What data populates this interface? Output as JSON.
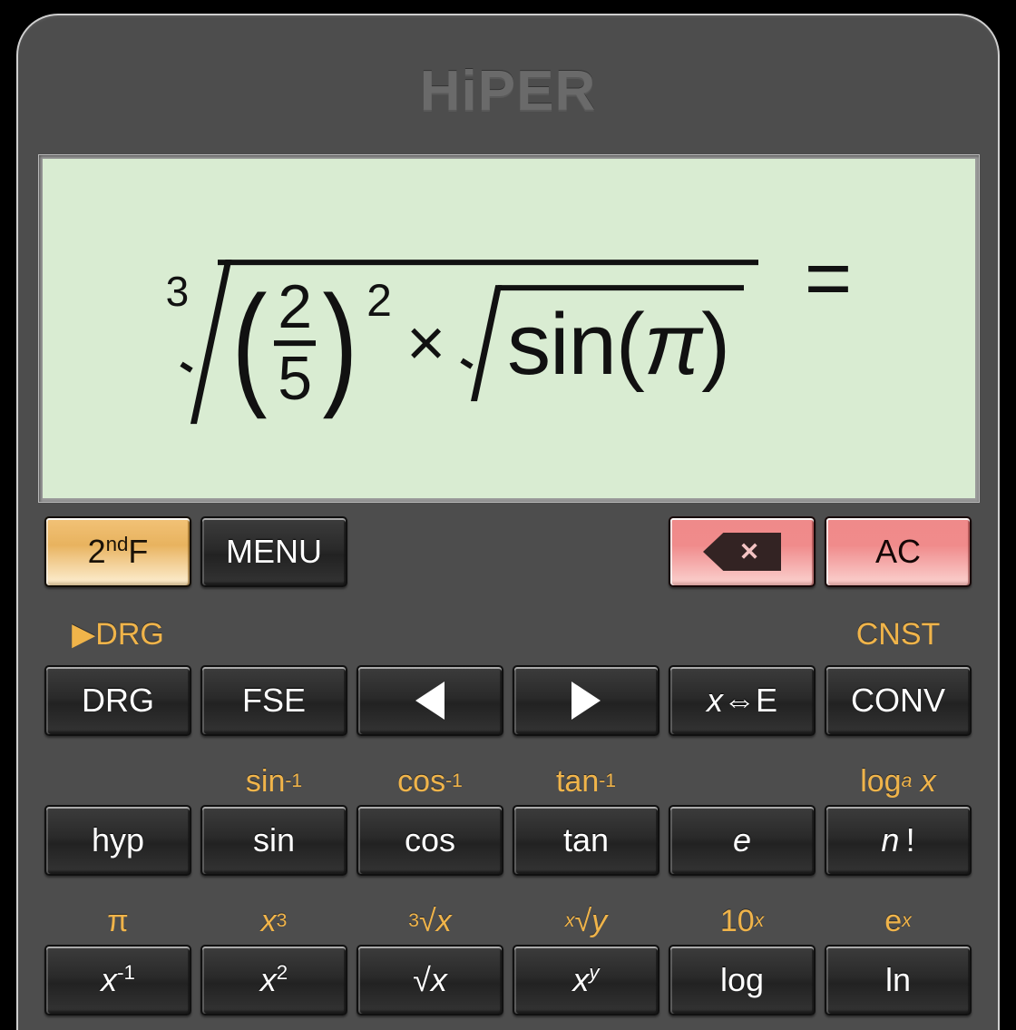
{
  "app": {
    "brand": "HiPER"
  },
  "display": {
    "expression_text": "3√((2/5)² × √sin(π)) =",
    "root_index": "3",
    "numerator": "2",
    "denominator": "5",
    "power": "2",
    "multiply_symbol": "×",
    "function_name": "sin",
    "open_paren": "(",
    "argument": "π",
    "close_paren": ")",
    "equals": "=",
    "background_color": "#d9ecd2",
    "ink_color": "#111111"
  },
  "colors": {
    "body": "#4d4d4d",
    "secondary_label": "#f0b44a",
    "second_function_key": "#f0c888",
    "clear_key": "#f08b8b",
    "key_face": "#2a2a2a"
  },
  "keypad": {
    "top_row": [
      {
        "label": "2ndF",
        "name": "second-function-button",
        "style": "gold",
        "sec": "▶DRG",
        "sec_name": "sec-label-drg"
      },
      {
        "label": "MENU",
        "name": "menu-button",
        "style": "dark",
        "sec": "",
        "sec_name": "sec-label-blank-1"
      },
      {
        "label": "",
        "name": "spacer-1",
        "style": "none",
        "sec": "",
        "sec_name": "sec-label-blank-2"
      },
      {
        "label": "",
        "name": "spacer-2",
        "style": "none",
        "sec": "",
        "sec_name": "sec-label-blank-3"
      },
      {
        "label": "backspace-icon",
        "name": "backspace-button",
        "style": "pink",
        "sec": "",
        "sec_name": "sec-label-blank-4"
      },
      {
        "label": "AC",
        "name": "all-clear-button",
        "style": "pink",
        "sec": "CNST",
        "sec_name": "sec-label-cnst"
      }
    ],
    "row_1": [
      {
        "label": "DRG",
        "name": "drg-button",
        "sec": "",
        "sec_name": "sec-label-blank-5"
      },
      {
        "label": "FSE",
        "name": "fse-button",
        "sec": "sin⁻¹",
        "sec_name": "sec-label-arcsin"
      },
      {
        "label": "arrow-left-icon",
        "name": "cursor-left-button",
        "sec": "cos⁻¹",
        "sec_name": "sec-label-arccos"
      },
      {
        "label": "arrow-right-icon",
        "name": "cursor-right-button",
        "sec": "tan⁻¹",
        "sec_name": "sec-label-arctan"
      },
      {
        "label": "x⇔E",
        "name": "x-exchange-e-button",
        "sec": "",
        "sec_name": "sec-label-blank-6"
      },
      {
        "label": "CONV",
        "name": "conversion-button",
        "sec": "logₐ x",
        "sec_name": "sec-label-log-base-a"
      }
    ],
    "row_2": [
      {
        "label": "hyp",
        "name": "hyperbolic-button",
        "sec": "π",
        "sec_name": "sec-label-pi"
      },
      {
        "label": "sin",
        "name": "sine-button",
        "sec": "x³",
        "sec_name": "sec-label-x-cubed"
      },
      {
        "label": "cos",
        "name": "cosine-button",
        "sec": "³√x",
        "sec_name": "sec-label-cube-root"
      },
      {
        "label": "tan",
        "name": "tangent-button",
        "sec": "ˣ√y",
        "sec_name": "sec-label-x-root-y"
      },
      {
        "label": "e",
        "name": "euler-number-button",
        "sec": "10ˣ",
        "sec_name": "sec-label-ten-pow-x"
      },
      {
        "label": "n!",
        "name": "factorial-button",
        "sec": "eˣ",
        "sec_name": "sec-label-e-pow-x"
      }
    ],
    "row_3": [
      {
        "label": "x⁻¹",
        "name": "reciprocal-button"
      },
      {
        "label": "x²",
        "name": "square-button"
      },
      {
        "label": "√x",
        "name": "square-root-button"
      },
      {
        "label": "xʸ",
        "name": "power-button"
      },
      {
        "label": "log",
        "name": "log-button"
      },
      {
        "label": "ln",
        "name": "natural-log-button"
      }
    ]
  }
}
